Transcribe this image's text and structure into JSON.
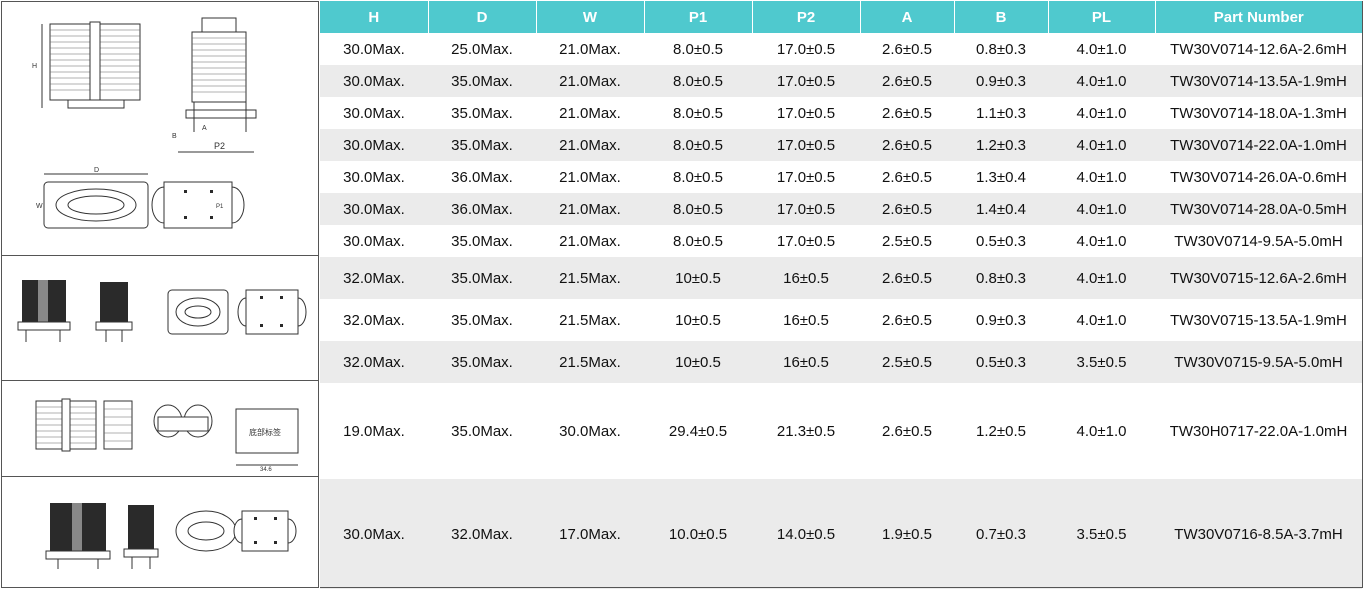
{
  "columns": [
    "H",
    "D",
    "W",
    "P1",
    "P2",
    "A",
    "B",
    "PL",
    "Part Number"
  ],
  "rows": [
    [
      "30.0Max.",
      "25.0Max.",
      "21.0Max.",
      "8.0±0.5",
      "17.0±0.5",
      "2.6±0.5",
      "0.8±0.3",
      "4.0±1.0",
      "TW30V0714-12.6A-2.6mH"
    ],
    [
      "30.0Max.",
      "35.0Max.",
      "21.0Max.",
      "8.0±0.5",
      "17.0±0.5",
      "2.6±0.5",
      "0.9±0.3",
      "4.0±1.0",
      "TW30V0714-13.5A-1.9mH"
    ],
    [
      "30.0Max.",
      "35.0Max.",
      "21.0Max.",
      "8.0±0.5",
      "17.0±0.5",
      "2.6±0.5",
      "1.1±0.3",
      "4.0±1.0",
      "TW30V0714-18.0A-1.3mH"
    ],
    [
      "30.0Max.",
      "35.0Max.",
      "21.0Max.",
      "8.0±0.5",
      "17.0±0.5",
      "2.6±0.5",
      "1.2±0.3",
      "4.0±1.0",
      "TW30V0714-22.0A-1.0mH"
    ],
    [
      "30.0Max.",
      "36.0Max.",
      "21.0Max.",
      "8.0±0.5",
      "17.0±0.5",
      "2.6±0.5",
      "1.3±0.4",
      "4.0±1.0",
      "TW30V0714-26.0A-0.6mH"
    ],
    [
      "30.0Max.",
      "36.0Max.",
      "21.0Max.",
      "8.0±0.5",
      "17.0±0.5",
      "2.6±0.5",
      "1.4±0.4",
      "4.0±1.0",
      "TW30V0714-28.0A-0.5mH"
    ],
    [
      "30.0Max.",
      "35.0Max.",
      "21.0Max.",
      "8.0±0.5",
      "17.0±0.5",
      "2.5±0.5",
      "0.5±0.3",
      "4.0±1.0",
      "TW30V0714-9.5A-5.0mH"
    ],
    [
      "32.0Max.",
      "35.0Max.",
      "21.5Max.",
      "10±0.5",
      "16±0.5",
      "2.6±0.5",
      "0.8±0.3",
      "4.0±1.0",
      "TW30V0715-12.6A-2.6mH"
    ],
    [
      "32.0Max.",
      "35.0Max.",
      "21.5Max.",
      "10±0.5",
      "16±0.5",
      "2.6±0.5",
      "0.9±0.3",
      "4.0±1.0",
      "TW30V0715-13.5A-1.9mH"
    ],
    [
      "32.0Max.",
      "35.0Max.",
      "21.5Max.",
      "10±0.5",
      "16±0.5",
      "2.5±0.5",
      "0.5±0.3",
      "3.5±0.5",
      "TW30V0715-9.5A-5.0mH"
    ],
    [
      "19.0Max.",
      "35.0Max.",
      "30.0Max.",
      "29.4±0.5",
      "21.3±0.5",
      "2.6±0.5",
      "1.2±0.5",
      "4.0±1.0",
      "TW30H0717-22.0A-1.0mH"
    ],
    [
      "30.0Max.",
      "32.0Max.",
      "17.0Max.",
      "10.0±0.5",
      "14.0±0.5",
      "1.9±0.5",
      "0.7±0.3",
      "3.5±0.5",
      "TW30V0716-8.5A-3.7mH"
    ]
  ],
  "colors": {
    "header_bg": "#4fc9ce",
    "header_text": "#ffffff",
    "alt_row": "#ebebeb"
  },
  "drawing_icons": [
    "vertical-choke-drawing-icon",
    "vertical-choke-compact-drawing-icon",
    "horizontal-choke-drawing-icon",
    "small-vertical-choke-drawing-icon"
  ],
  "drawing_labels": {
    "d1_p2": "P2",
    "d1_h": "H",
    "d1_b": "B",
    "d1_a": "A",
    "d1_d": "D",
    "d1_w": "W",
    "d1_p1": "P1",
    "d3_chinese": "底部标签",
    "d3_dim": "34.6"
  }
}
